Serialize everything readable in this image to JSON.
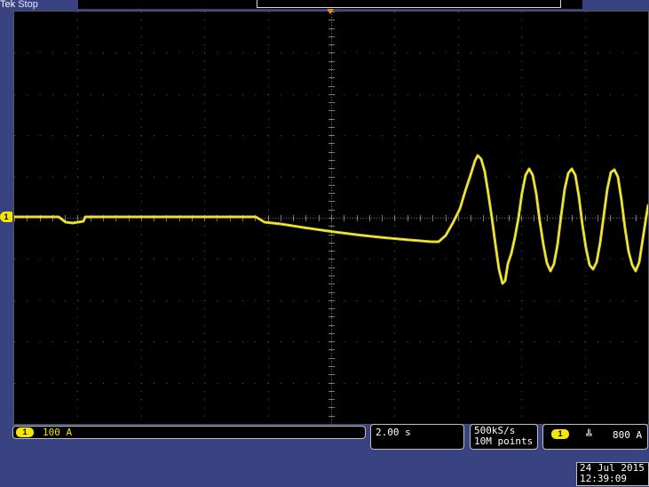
{
  "header": {
    "brand": "Tek",
    "state": "Stop"
  },
  "channel1": {
    "marker_label": "1",
    "badge_label": "1",
    "scale": "100 A",
    "color": "#f4e600"
  },
  "timebase": {
    "scale": "2.00 s"
  },
  "acquisition": {
    "sample_rate": "500kS/s",
    "record_length": "10M points"
  },
  "trigger": {
    "source_label": "1",
    "slope_icon": "falling-edge-icon",
    "slope_glyph": "⌐",
    "level": "800 A"
  },
  "datetime": {
    "date": "24 Jul  2015",
    "time": "12:39:09"
  },
  "colors": {
    "background": "#3a4381",
    "trace": "#f4e600",
    "trigger_marker": "#f08c00"
  }
}
